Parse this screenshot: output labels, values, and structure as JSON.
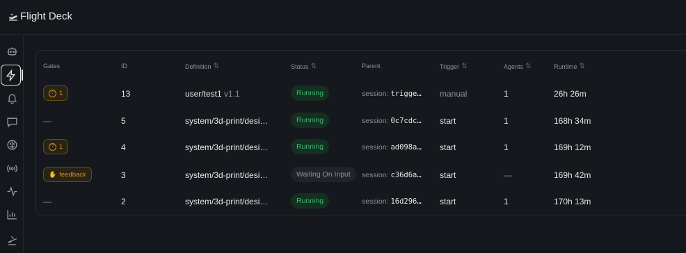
{
  "app": {
    "title": "Flight Deck"
  },
  "sidebar": {
    "items": [
      {
        "icon": "robot-icon"
      },
      {
        "icon": "lightning-icon",
        "active": true
      },
      {
        "icon": "bell-icon"
      },
      {
        "icon": "chat-icon"
      },
      {
        "icon": "brain-icon"
      },
      {
        "icon": "broadcast-icon"
      },
      {
        "icon": "activity-icon"
      },
      {
        "icon": "bar-chart-icon"
      },
      {
        "icon": "flight-icon"
      }
    ]
  },
  "table": {
    "headers": {
      "gates": "Gates",
      "id": "ID",
      "definition": "Definition",
      "status": "Status",
      "parent": "Parent",
      "trigger": "Trigger",
      "agents": "Agents",
      "runtime": "Runtime"
    },
    "rows": [
      {
        "gate": "1",
        "gate_type": "question",
        "id": "13",
        "definition": "user/test1",
        "version": "v1.1",
        "status": "Running",
        "parent_prefix": "session:",
        "parent_id": "trigge…",
        "trigger": "manual",
        "agents": "1",
        "runtime": "26h 26m"
      },
      {
        "gate": "—",
        "gate_type": "none",
        "id": "5",
        "definition": "system/3d-print/desi…",
        "version": "",
        "status": "Running",
        "parent_prefix": "session:",
        "parent_id": "0c7cdc…",
        "trigger": "start",
        "agents": "1",
        "runtime": "168h 34m"
      },
      {
        "gate": "1",
        "gate_type": "question",
        "id": "4",
        "definition": "system/3d-print/desi…",
        "version": "",
        "status": "Running",
        "parent_prefix": "session:",
        "parent_id": "ad098a…",
        "trigger": "start",
        "agents": "1",
        "runtime": "169h 12m"
      },
      {
        "gate": "feedback",
        "gate_type": "feedback",
        "id": "3",
        "definition": "system/3d-print/desi…",
        "version": "",
        "status": "Waiting On Input",
        "parent_prefix": "session:",
        "parent_id": "c36d6a…",
        "trigger": "start",
        "agents": "—",
        "runtime": "169h 42m"
      },
      {
        "gate": "—",
        "gate_type": "none",
        "id": "2",
        "definition": "system/3d-print/desi…",
        "version": "",
        "status": "Running",
        "parent_prefix": "session:",
        "parent_id": "16d296…",
        "trigger": "start",
        "agents": "1",
        "runtime": "170h 13m"
      }
    ]
  },
  "colors": {
    "background": "#14171b",
    "running": "#3fb56f",
    "gate": "#c98f2a"
  }
}
